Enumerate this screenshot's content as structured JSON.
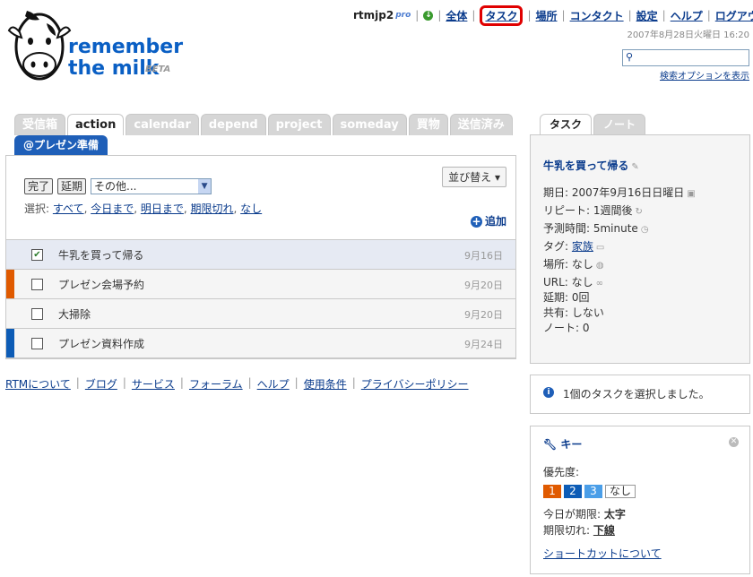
{
  "logo": {
    "line1": "remember",
    "line2": "the milk",
    "beta": "BETA"
  },
  "topnav": {
    "user": "rtmjp2",
    "pro": "pro",
    "links": [
      "全体",
      "タスク",
      "場所",
      "コンタクト",
      "設定",
      "ヘルプ",
      "ログアウト"
    ]
  },
  "date": "2007年8月28日火曜日 16:20",
  "search": {
    "value": "",
    "options_link": "検索オプションを表示"
  },
  "tabs": [
    "受信箱",
    "action",
    "calendar",
    "depend",
    "project",
    "someday",
    "買物",
    "送信済み"
  ],
  "active_tab": "action",
  "list_tab": "@プレゼン準備",
  "toolbar": {
    "complete": "完了",
    "postpone": "延期",
    "other": "その他...",
    "sort": "並び替え"
  },
  "select_line": {
    "label": "選択:",
    "links": [
      "すべて",
      "今日まで",
      "明日まで",
      "期限切れ",
      "なし"
    ]
  },
  "add_label": "追加",
  "tasks": [
    {
      "name": "牛乳を買って帰る",
      "due": "9月16日",
      "checked": true,
      "priority_color": "",
      "selected": true
    },
    {
      "name": "プレゼン会場予約",
      "due": "9月20日",
      "checked": false,
      "priority_color": "#e05a00",
      "selected": false
    },
    {
      "name": "大掃除",
      "due": "9月20日",
      "checked": false,
      "priority_color": "",
      "selected": false
    },
    {
      "name": "プレゼン資料作成",
      "due": "9月24日",
      "checked": false,
      "priority_color": "#0d5cb6",
      "selected": false
    }
  ],
  "footer_links": [
    "RTMについて",
    "ブログ",
    "サービス",
    "フォーラム",
    "ヘルプ",
    "使用条件",
    "プライバシーポリシー"
  ],
  "right_tabs": [
    "タスク",
    "ノート"
  ],
  "detail": {
    "title": "牛乳を買って帰る",
    "due": "期日: 2007年9月16日日曜日",
    "repeat": "リピート: 1週間後",
    "estimate": "予測時間: 5minute",
    "tags_label": "タグ:",
    "tags_value": "家族",
    "location": "場所: なし",
    "url": "URL: なし",
    "postponed": "延期: 0回",
    "shared": "共有: しない",
    "notes": "ノート: 0"
  },
  "info": "1個のタスクを選択しました。",
  "keys": {
    "title": "キー",
    "priority_label": "優先度:",
    "priorities": [
      {
        "label": "1",
        "color": "#e05a00"
      },
      {
        "label": "2",
        "color": "#0d5cb6"
      },
      {
        "label": "3",
        "color": "#4a9ee8"
      },
      {
        "label": "なし",
        "color": "#ffffff"
      }
    ],
    "due_today_label": "今日が期限:",
    "due_today_value": "太字",
    "overdue_label": "期限切れ:",
    "overdue_value": "下線",
    "shortcuts_link": "ショートカットについて"
  }
}
